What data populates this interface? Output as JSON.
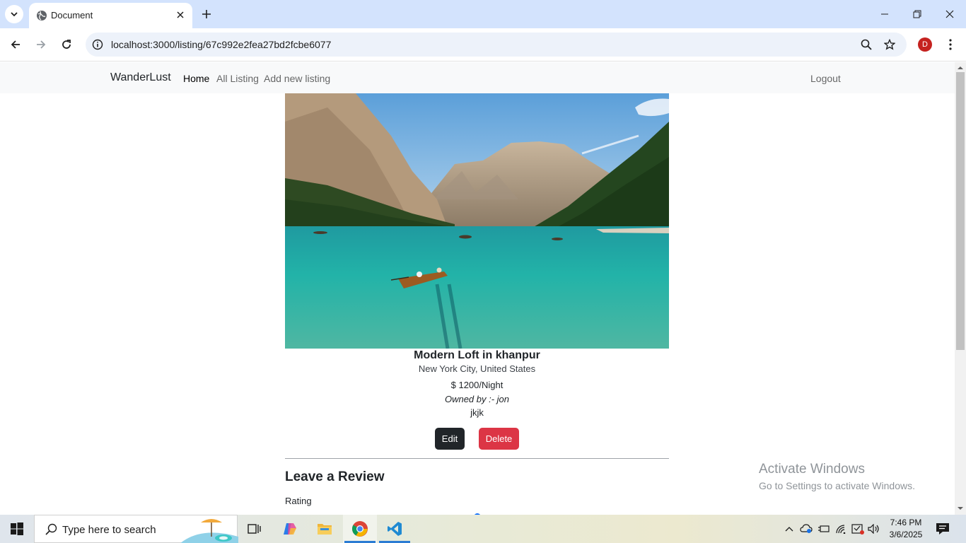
{
  "browser": {
    "tab_title": "Document",
    "url": "localhost:3000/listing/67c992e2fea27bd2fcbe6077",
    "profile_initial": "D"
  },
  "site": {
    "brand": "WanderLust",
    "nav": {
      "home": "Home",
      "all_listing": "All Listing",
      "add_new": "Add new listing",
      "logout": "Logout"
    }
  },
  "listing": {
    "title": "Modern Loft in khanpur",
    "location": "New York City, United States",
    "price": "$ 1200/Night",
    "owner": "Owned by :- jon",
    "description": "jkjk",
    "edit_label": "Edit",
    "delete_label": "Delete"
  },
  "review": {
    "heading": "Leave a Review",
    "rating_label": "Rating"
  },
  "watermark": {
    "line1": "Activate Windows",
    "line2": "Go to Settings to activate Windows."
  },
  "taskbar": {
    "search_placeholder": "Type here to search",
    "time": "7:46 PM",
    "date": "3/6/2025"
  },
  "colors": {
    "delete": "#dc3545",
    "edit": "#212529",
    "tabstrip": "#d3e3fd"
  }
}
